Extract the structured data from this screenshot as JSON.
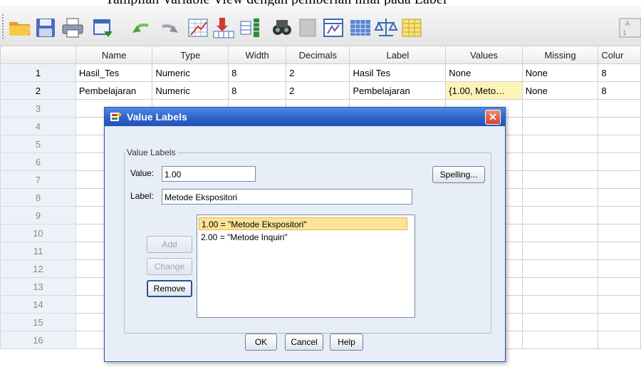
{
  "top_text": "Tampilan Variable View dengan pemberian nilai pada Label",
  "toolbar": {
    "icons": [
      "open-folder-icon",
      "save-icon",
      "print-icon",
      "dialog-recall-icon",
      "undo-icon",
      "redo-icon",
      "goto-case-icon",
      "goto-variable-icon",
      "variables-icon",
      "find-icon",
      "insert-case-icon",
      "insert-variable-icon",
      "split-file-icon",
      "weight-cases-icon",
      "select-cases-icon",
      "value-labels-icon"
    ]
  },
  "grid": {
    "columns": [
      "",
      "Name",
      "Type",
      "Width",
      "Decimals",
      "Label",
      "Values",
      "Missing",
      "Colur"
    ],
    "rows": [
      {
        "num": "1",
        "name": "Hasil_Tes",
        "type": "Numeric",
        "width": "8",
        "decimals": "2",
        "label": "Hasil Tes",
        "values": "None",
        "missing": "None",
        "columns": "8"
      },
      {
        "num": "2",
        "name": "Pembelajaran",
        "type": "Numeric",
        "width": "8",
        "decimals": "2",
        "label": "Pembelajaran",
        "values": "{1.00, Meto…",
        "missing": "None",
        "columns": "8"
      },
      {
        "num": "3"
      },
      {
        "num": "4"
      },
      {
        "num": "5"
      },
      {
        "num": "6"
      },
      {
        "num": "7"
      },
      {
        "num": "8"
      },
      {
        "num": "9"
      },
      {
        "num": "10"
      },
      {
        "num": "11"
      },
      {
        "num": "12"
      },
      {
        "num": "13"
      },
      {
        "num": "14"
      },
      {
        "num": "15"
      },
      {
        "num": "16"
      }
    ]
  },
  "dialog": {
    "title": "Value Labels",
    "close_label": "✕",
    "group_label": "Value Labels",
    "value_label": "Value:",
    "value_input": "1.00",
    "label_label": "Label:",
    "label_input": "Metode Ekspositori",
    "spelling_button": "Spelling...",
    "add_button": "Add",
    "change_button": "Change",
    "remove_button": "Remove",
    "list_items": [
      "1.00 = \"Metode Ekspositori\"",
      "2.00 = \"Metode Inquiri\""
    ],
    "ok_button": "OK",
    "cancel_button": "Cancel",
    "help_button": "Help"
  }
}
